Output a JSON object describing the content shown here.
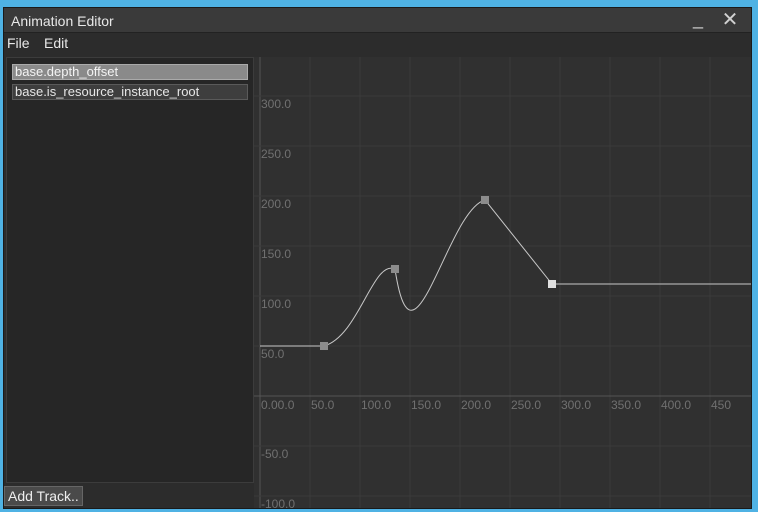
{
  "window": {
    "title": "Animation Editor"
  },
  "menu": {
    "file": "File",
    "edit": "Edit"
  },
  "tracks": [
    {
      "label": "base.depth_offset",
      "selected": true
    },
    {
      "label": "base.is_resource_instance_root",
      "selected": false
    }
  ],
  "add_track_label": "Add Track..",
  "graph": {
    "x_ticks": [
      "0.00.0",
      "50.0",
      "100.0",
      "150.0",
      "200.0",
      "250.0",
      "300.0",
      "350.0",
      "400.0",
      "450"
    ],
    "y_ticks": [
      "300.0",
      "250.0",
      "200.0",
      "150.0",
      "100.0",
      "50.0",
      "-50.0",
      "-100.0"
    ],
    "keyframes": [
      {
        "time": 0,
        "value": 50
      },
      {
        "time": 64,
        "value": 50
      },
      {
        "time": 135,
        "value": 127
      },
      {
        "time": 225,
        "value": 196
      },
      {
        "time": 292,
        "value": 112
      }
    ],
    "colors": {
      "curve": "#c8c8c8",
      "grid": "#3a3a3a",
      "axis": "#555555",
      "keyframe": "#8c8c8c",
      "keyframe_selected": "#e0e0e0"
    }
  }
}
